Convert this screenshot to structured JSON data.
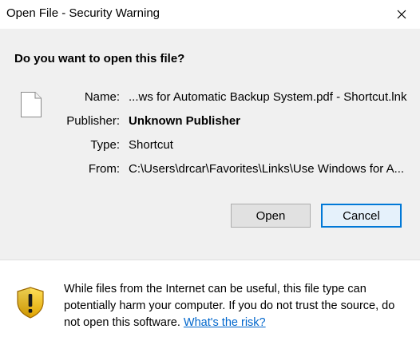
{
  "window": {
    "title": "Open File - Security Warning",
    "close_icon": "close-icon"
  },
  "dialog": {
    "question": "Do you want to open this file?",
    "file_icon": "document-icon",
    "fields": {
      "name_label": "Name:",
      "name_value": "...ws for Automatic Backup System.pdf - Shortcut.lnk",
      "publisher_label": "Publisher:",
      "publisher_value": "Unknown Publisher",
      "type_label": "Type:",
      "type_value": "Shortcut",
      "from_label": "From:",
      "from_value": "C:\\Users\\drcar\\Favorites\\Links\\Use Windows for A..."
    },
    "buttons": {
      "open_label": "Open",
      "cancel_label": "Cancel"
    }
  },
  "footer": {
    "shield_icon": "security-shield-icon",
    "warning_text": "While files from the Internet can be useful, this file type can potentially harm your computer. If you do not trust the source, do not open this software. ",
    "risk_link": "What's the risk?"
  },
  "colors": {
    "dialog_background": "#f0f0f0",
    "accent": "#0078d7",
    "link": "#0066cc",
    "shield_yellow": "#f5c400"
  }
}
